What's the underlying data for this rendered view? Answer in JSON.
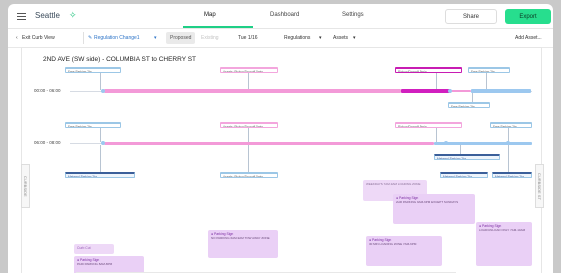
{
  "app": {
    "brand": "Seattle",
    "brand_icon": "green-sparkle-icon"
  },
  "nav": {
    "tabs": [
      "Map",
      "Dashboard",
      "Settings"
    ],
    "active": "Map",
    "accent": "#1fcf86"
  },
  "header": {
    "share_label": "Share",
    "export_label": "Export",
    "export_color": "#27de8e"
  },
  "toolbar": {
    "exit_label": "Exit Curb View",
    "regulation_change_label": "Regulation Change1",
    "proposed_label": "Proposed",
    "existing_label": "Existing",
    "date_label": "Tue 1/16",
    "regulations_label": "Regulations",
    "assets_label": "Assets",
    "add_asset_label": "Add Asset..."
  },
  "panel": {
    "street_title": "2ND AVE (SW side) - COLUMBIA ST to CHERRY ST",
    "left_tab": "CURBSIDE",
    "right_tab": "CURBSIDE ST"
  },
  "timelines": [
    {
      "label": "00:00 - 06:00"
    },
    {
      "label": "06:00 - 08:00"
    }
  ],
  "chips_row1": [
    {
      "text": "Free Parking 2hr"
    },
    {
      "text": "Assets: Pickup/Dropoff 5min"
    },
    {
      "text": "Pickup/Dropoff 5min"
    },
    {
      "text": "Free Parking 2hr"
    }
  ],
  "chips_row1b": [
    {
      "text": "Free Parking 2hr"
    }
  ],
  "chips_row2": [
    {
      "text": "Free Parking 2hr"
    },
    {
      "text": "Assets: Pickup/Dropoff 5min"
    },
    {
      "text": "Pickup/Dropoff 5min"
    },
    {
      "text": "Free Parking 2hr"
    }
  ],
  "chips_row3": [
    {
      "text": "Metered Parking 2hr"
    },
    {
      "text": "Metered Parking 2hr"
    },
    {
      "text": "Assets: Pickup/Dropoff 5min"
    },
    {
      "text": "Metered Parking 2hr"
    },
    {
      "text": "Metered Parking 2hr"
    }
  ],
  "cards": [
    {
      "title": "",
      "body": "WEEKDAYS 7AM-9AM LOADING ZONE"
    },
    {
      "title": "Parking Sign",
      "body": "2HR PARKING 9AM-6PM EXCEPT SUNDAYS"
    },
    {
      "title": "Parking Sign",
      "body": "NO PARKING 6AM-9AM TOW AWAY ZONE"
    },
    {
      "title": "Parking Sign",
      "body": "30 MIN LOADING ZONE 7AM-6PM"
    },
    {
      "title": "Parking Sign",
      "body": "LOAD/UNLOAD ONLY 7AM-10AM"
    },
    {
      "title": "Curb Cut",
      "body": ""
    },
    {
      "title": "Parking Sign",
      "body": "PAID PARKING 8AM-8PM"
    }
  ]
}
